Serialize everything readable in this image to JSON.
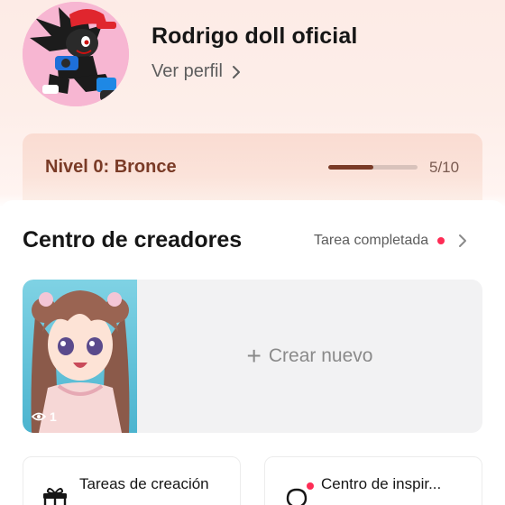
{
  "profile": {
    "name": "Rodrigo doll oficial",
    "view_profile_label": "Ver perfil"
  },
  "level": {
    "label": "Nivel 0: Bronce",
    "progress_text": "5/10",
    "progress_fraction": 0.5
  },
  "creators": {
    "title": "Centro de creadores",
    "task_label": "Tarea completada",
    "video_views": "1",
    "create_new_label": "Crear nuevo"
  },
  "cards": [
    {
      "label": "Tareas de creación",
      "icon": "gift-icon"
    },
    {
      "label": "Centro de inspir...",
      "icon": "lightbulb-icon"
    }
  ],
  "colors": {
    "accent_red": "#fe2c55",
    "level_brown": "#7a3b27"
  }
}
